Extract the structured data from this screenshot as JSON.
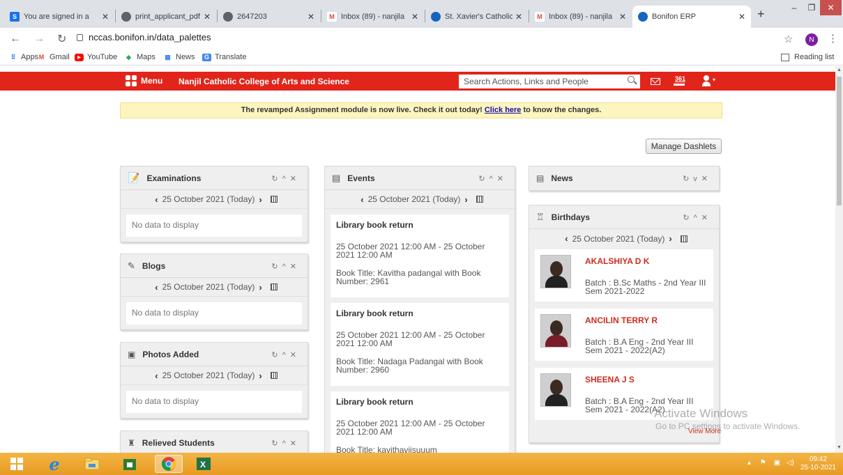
{
  "browser": {
    "tabs": [
      {
        "title": "You are signed in a",
        "fav_color": "#1a73e8",
        "fav_text": "S"
      },
      {
        "title": "print_applicant_pdf",
        "fav_color": "#5f6368",
        "fav_text": ""
      },
      {
        "title": "2647203",
        "fav_color": "#5f6368",
        "fav_text": ""
      },
      {
        "title": "Inbox (89) - nanjila",
        "fav_color": "#ea4335",
        "fav_text": "M"
      },
      {
        "title": "St. Xavier's Catholic",
        "fav_color": "#1565c0",
        "fav_text": ""
      },
      {
        "title": "Inbox (89) - nanjila",
        "fav_color": "#ea4335",
        "fav_text": "M"
      },
      {
        "title": "Bonifon ERP",
        "fav_color": "#1565c0",
        "fav_text": ""
      }
    ],
    "url": "nccas.bonifon.in/data_palettes",
    "profile_initial": "N",
    "bookmarks": [
      "Apps",
      "Gmail",
      "YouTube",
      "Maps",
      "News",
      "Translate"
    ],
    "reading_list": "Reading list"
  },
  "erp": {
    "menu_label": "Menu",
    "college_name": "Nanjil Catholic College of Arts and Science",
    "search_placeholder": "Search Actions, Links and People",
    "notification_count": "361"
  },
  "announcement": {
    "text_before": "The revamped Assignment module is now live. Check it out today!",
    "link_text": "Click here",
    "text_after": "to know the changes."
  },
  "manage_dashlets_label": "Manage Dashlets",
  "date_label": "25 October 2021 (Today)",
  "no_data": "No data to display",
  "dashlets": {
    "examinations": "Examinations",
    "blogs": "Blogs",
    "photos": "Photos Added",
    "relieved": "Relieved Students",
    "events": "Events",
    "news": "News",
    "birthdays": "Birthdays"
  },
  "events": [
    {
      "title": "Library book return",
      "time": "25 October 2021 12:00 AM - 25 October 2021 12:00 AM",
      "detail": "Book Title: Kavitha padangal with Book Number: 2961"
    },
    {
      "title": "Library book return",
      "time": "25 October 2021 12:00 AM - 25 October 2021 12:00 AM",
      "detail": "Book Title: Nadaga Padangal with Book Number: 2960"
    },
    {
      "title": "Library book return",
      "time": "25 October 2021 12:00 AM - 25 October 2021 12:00 AM",
      "detail": "Book Title: kavithaviisuuum"
    }
  ],
  "birthdays": [
    {
      "name": "AKALSHIYA D K",
      "batch": "Batch : B.Sc Maths - 2nd Year III Sem 2021-2022"
    },
    {
      "name": "ANCILIN TERRY R",
      "batch": "Batch : B.A Eng - 2nd Year III Sem 2021 - 2022(A2)"
    },
    {
      "name": "SHEENA J S",
      "batch": "Batch : B.A Eng - 2nd Year III Sem 2021 - 2022(A2)"
    }
  ],
  "view_more": "View More",
  "watermark": {
    "line1": "Activate Windows",
    "line2": "Go to PC settings to activate Windows."
  },
  "taskbar": {
    "time": "09:42",
    "date": "25-10-2021"
  }
}
